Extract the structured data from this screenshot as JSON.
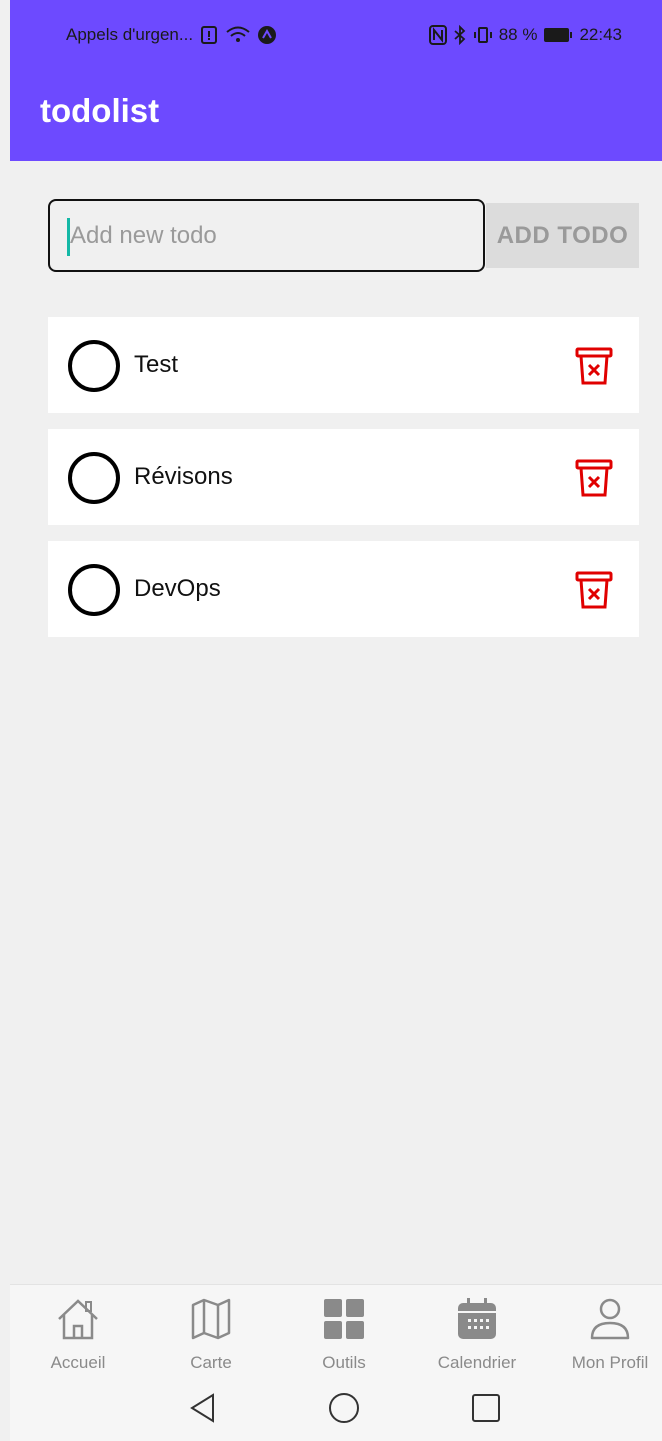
{
  "status_bar": {
    "carrier_text": "Appels d'urgen...",
    "battery_percent": "88 %",
    "time": "22:43"
  },
  "app": {
    "title": "todolist"
  },
  "new_todo": {
    "value": "",
    "placeholder": "Add new todo",
    "button_label": "ADD TODO"
  },
  "todos": [
    {
      "label": "Test",
      "done": false
    },
    {
      "label": "Révisons",
      "done": false
    },
    {
      "label": "DevOps",
      "done": false
    }
  ],
  "bottom_nav": {
    "items": [
      {
        "label": "Accueil",
        "icon": "home-icon"
      },
      {
        "label": "Carte",
        "icon": "map-icon"
      },
      {
        "label": "Outils",
        "icon": "grid-icon"
      },
      {
        "label": "Calendrier",
        "icon": "calendar-icon"
      },
      {
        "label": "Mon Profil",
        "icon": "profile-icon"
      }
    ]
  },
  "colors": {
    "primary": "#6d4aff",
    "delete": "#e00000",
    "background": "#f0f0f0"
  }
}
